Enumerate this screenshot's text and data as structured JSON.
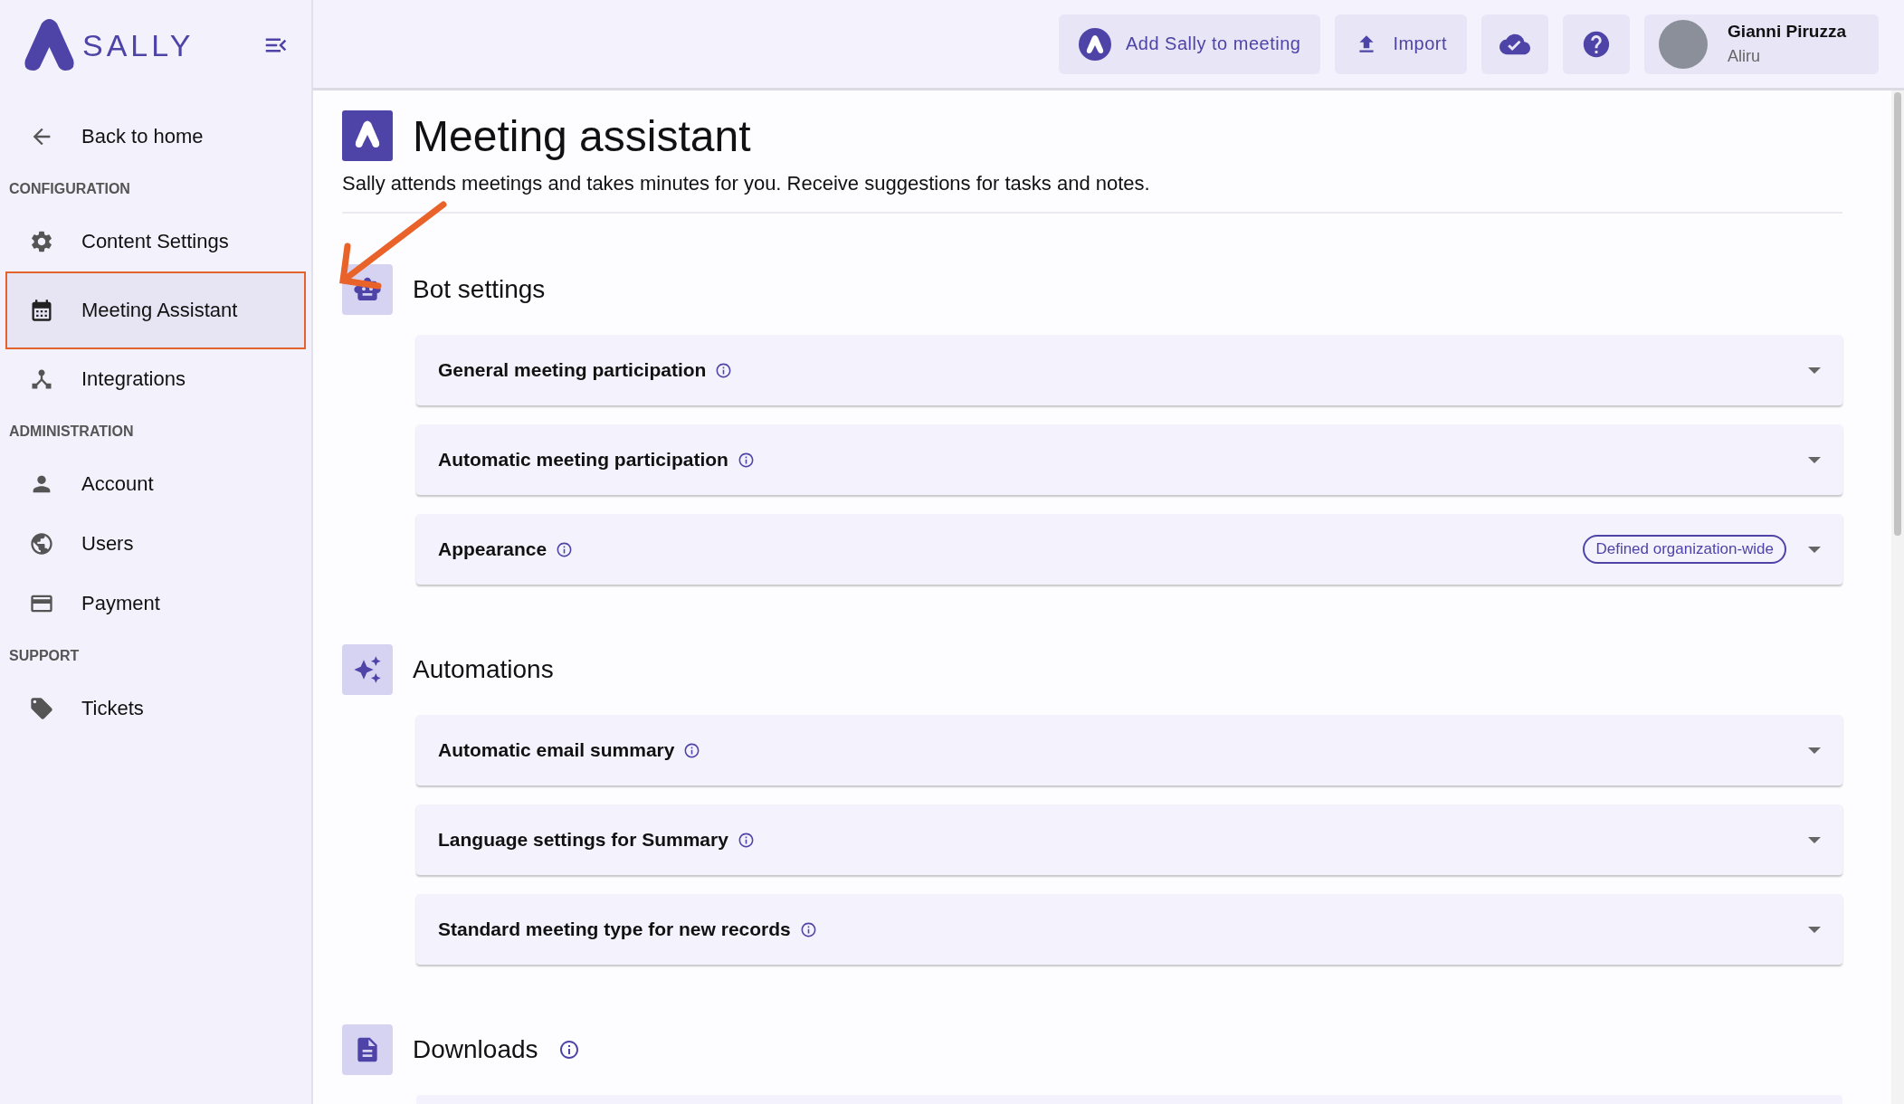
{
  "brand": {
    "name": "SALLY"
  },
  "sidebar": {
    "back": "Back to home",
    "groups": [
      {
        "heading": "CONFIGURATION",
        "items": [
          {
            "label": "Content Settings",
            "selected": false,
            "highlighted": false
          },
          {
            "label": "Meeting Assistant",
            "selected": true,
            "highlighted": true
          },
          {
            "label": "Integrations",
            "selected": false,
            "highlighted": false
          }
        ]
      },
      {
        "heading": "ADMINISTRATION",
        "items": [
          {
            "label": "Account",
            "selected": false,
            "highlighted": false
          },
          {
            "label": "Users",
            "selected": false,
            "highlighted": false
          },
          {
            "label": "Payment",
            "selected": false,
            "highlighted": false
          }
        ]
      },
      {
        "heading": "SUPPORT",
        "items": [
          {
            "label": "Tickets",
            "selected": false,
            "highlighted": false
          }
        ]
      }
    ]
  },
  "topbar": {
    "buttons": [
      {
        "kind": "logo",
        "label": "Add Sally to meeting"
      },
      {
        "kind": "upload",
        "label": "Import"
      },
      {
        "kind": "cloud"
      },
      {
        "kind": "help"
      }
    ],
    "user": {
      "name": "Gianni Piruzza",
      "org": "Aliru"
    }
  },
  "page": {
    "title": "Meeting assistant",
    "subtitle": "Sally attends meetings and takes minutes for you. Receive suggestions for tasks and notes.",
    "annotation_arrow": true,
    "sections": [
      {
        "title": "Bot settings",
        "items": [
          {
            "title": "General meeting participation",
            "info": true,
            "expanded": false
          },
          {
            "title": "Automatic meeting participation",
            "info": true,
            "expanded": false
          },
          {
            "title": "Appearance",
            "info": true,
            "expanded": false,
            "badge": "Defined organization-wide"
          }
        ]
      },
      {
        "title": "Automations",
        "items": [
          {
            "title": "Automatic email summary",
            "info": true,
            "expanded": false
          },
          {
            "title": "Language settings for Summary",
            "info": true,
            "expanded": false
          },
          {
            "title": "Standard meeting type for new records",
            "info": true,
            "expanded": false
          }
        ]
      },
      {
        "title": "Downloads",
        "info": true,
        "more_below": true
      }
    ]
  }
}
